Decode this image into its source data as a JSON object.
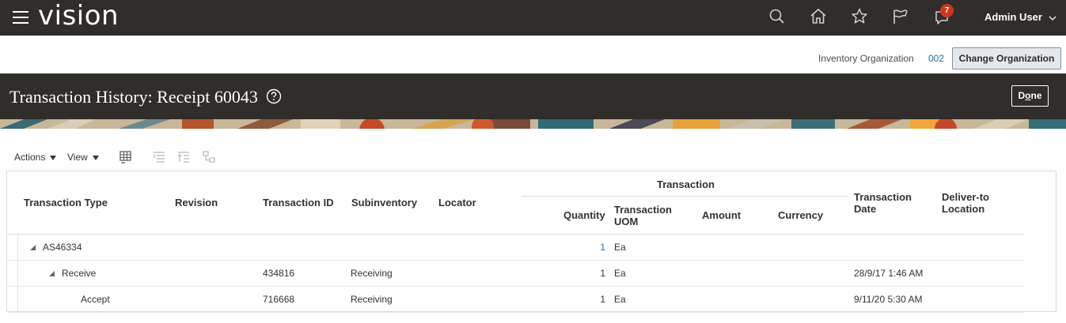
{
  "header": {
    "logo": "vision",
    "notification_count": "7",
    "user_name": "Admin User",
    "icons": [
      "search-icon",
      "home-icon",
      "star-icon",
      "flag-icon",
      "notifications-icon"
    ]
  },
  "org_bar": {
    "label": "Inventory Organization",
    "value": "002",
    "change_button": "Change Organization"
  },
  "page": {
    "title": "Transaction History: Receipt 60043",
    "done_label_pre": "D",
    "done_label_u": "o",
    "done_label_post": "ne"
  },
  "toolbar": {
    "actions": "Actions",
    "view": "View"
  },
  "table": {
    "group_header": "Transaction",
    "columns": {
      "transaction_type": "Transaction Type",
      "revision": "Revision",
      "transaction_id": "Transaction ID",
      "subinventory": "Subinventory",
      "locator": "Locator",
      "quantity": "Quantity",
      "uom_line1": "Transaction",
      "uom_line2": "UOM",
      "amount": "Amount",
      "currency": "Currency",
      "date_line1": "Transaction",
      "date_line2": "Date",
      "deliver_line1": "Deliver-to",
      "deliver_line2": "Location"
    },
    "rows": [
      {
        "type": "AS46334",
        "revision": "",
        "transaction_id": "",
        "subinventory": "",
        "locator": "",
        "quantity": "1",
        "uom": "Ea",
        "amount": "",
        "currency": "",
        "date": "",
        "deliver_to": ""
      },
      {
        "type": "Receive",
        "revision": "",
        "transaction_id": "434816",
        "subinventory": "Receiving",
        "locator": "",
        "quantity": "1",
        "uom": "Ea",
        "amount": "",
        "currency": "",
        "date": "28/9/17 1:46 AM",
        "deliver_to": ""
      },
      {
        "type": "Accept",
        "revision": "",
        "transaction_id": "716668",
        "subinventory": "Receiving",
        "locator": "",
        "quantity": "1",
        "uom": "Ea",
        "amount": "",
        "currency": "",
        "date": "9/11/20 5:30 AM",
        "deliver_to": ""
      }
    ]
  },
  "colors": {
    "header_bg": "#312d2a",
    "link": "#1c6ea4",
    "badge": "#d0361f"
  }
}
